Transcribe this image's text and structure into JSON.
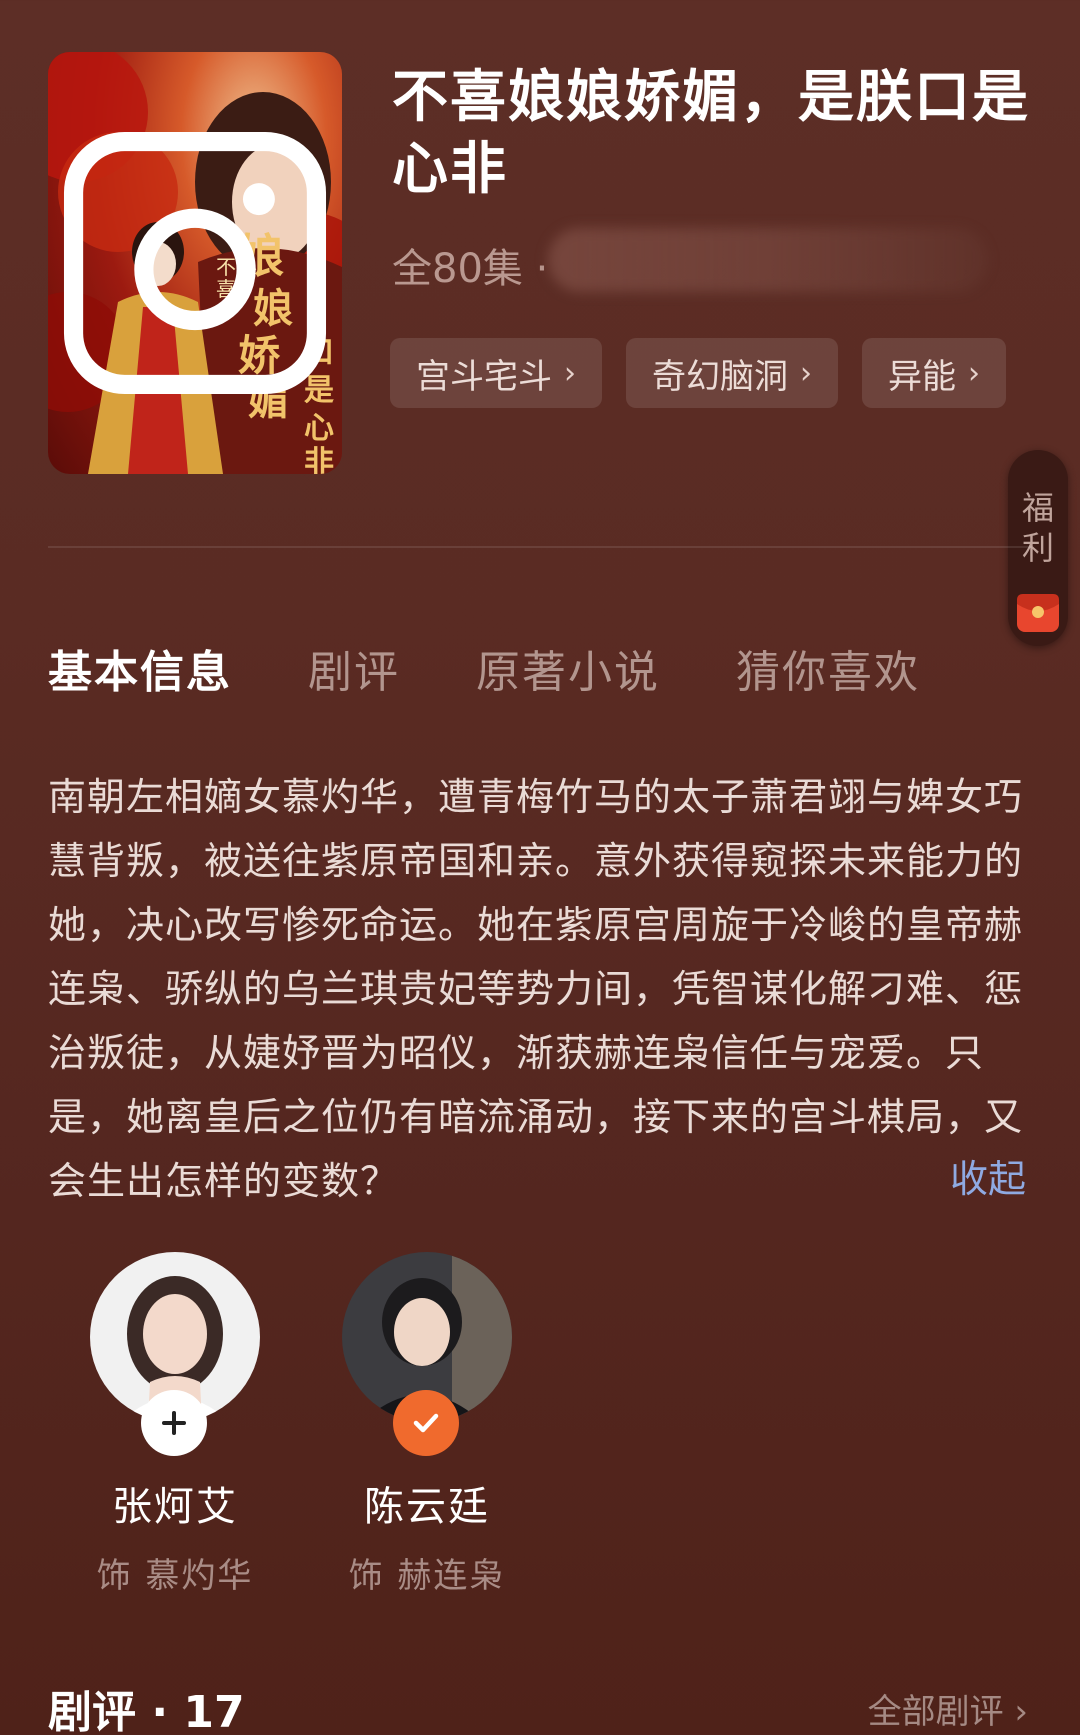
{
  "show": {
    "title": "不喜娘娘娇媚，是朕口是心非",
    "episodes": "全80集 ·"
  },
  "tags": [
    {
      "label": "宫斗宅斗"
    },
    {
      "label": "奇幻脑洞"
    },
    {
      "label": "异能"
    }
  ],
  "poster": {
    "title_art": "不喜娘娘娇媚，是朕口是心非"
  },
  "floating_button": {
    "label": "福\n利"
  },
  "tabs": [
    {
      "label": "基本信息"
    },
    {
      "label": "剧评"
    },
    {
      "label": "原著小说"
    },
    {
      "label": "猜你喜欢"
    }
  ],
  "synopsis": {
    "text": "南朝左相嫡女慕灼华，遭青梅竹马的太子萧君翊与婢女巧慧背叛，被送往紫原帝国和亲。意外获得窥探未来能力的她，决心改写惨死命运。她在紫原宫周旋于冷峻的皇帝赫连枭、骄纵的乌兰琪贵妃等势力间，凭智谋化解刁难、惩治叛徒，从婕妤晋为昭仪，渐获赫连枭信任与宠爱。只是，她离皇后之位仍有暗流涌动，接下来的宫斗棋局，又会生出怎样的变数？",
    "collapse_label": "收起"
  },
  "cast": [
    {
      "name": "张炣艾",
      "role": "饰 慕灼华",
      "badge": "plus-icon"
    },
    {
      "name": "陈云廷",
      "role": "饰 赫连枭",
      "badge": "check-icon"
    }
  ],
  "reviews": {
    "title": "剧评 · 17",
    "all_label": "全部剧评 ›"
  },
  "colors": {
    "background": "#5a2b23",
    "accent_link": "#8faae2",
    "check_badge": "#f06a2d"
  }
}
